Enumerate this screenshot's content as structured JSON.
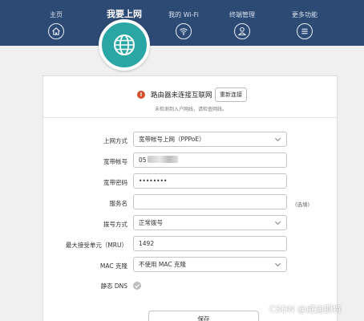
{
  "nav": {
    "items": [
      {
        "label": "主页",
        "icon": "home-icon"
      },
      {
        "label": "我要上网",
        "icon": "globe-icon",
        "active": true
      },
      {
        "label": "我的 Wi-Fi",
        "icon": "wifi-icon"
      },
      {
        "label": "终端管理",
        "icon": "user-icon"
      },
      {
        "label": "更多功能",
        "icon": "menu-icon"
      }
    ],
    "bar_color": "#2c4a74",
    "active_color": "#2aa7a4"
  },
  "status": {
    "warning_glyph": "!",
    "message": "路由器未连接互联网",
    "reconnect_label": "重新连接",
    "hint": "未检测到入户网线，请检查网线。",
    "warning_color": "#d2502a"
  },
  "form": {
    "connection_type": {
      "label": "上网方式",
      "value": "宽带帐号上网（PPPoE）"
    },
    "account": {
      "label": "宽带帐号",
      "value": "05"
    },
    "password": {
      "label": "宽带密码",
      "value": "••••••••"
    },
    "service_name": {
      "label": "服务名",
      "value": "",
      "optional_text": "(选填)"
    },
    "dial_mode": {
      "label": "拨号方式",
      "value": "正常拨号"
    },
    "mru": {
      "label": "最大接受单元（MRU）",
      "value": "1492"
    },
    "mac_clone": {
      "label": "MAC 克隆",
      "value": "不使用 MAC 克隆"
    },
    "static_dns": {
      "label": "静态 DNS"
    }
  },
  "save_label": "保存",
  "watermark": "CSDN @威迪斯特"
}
